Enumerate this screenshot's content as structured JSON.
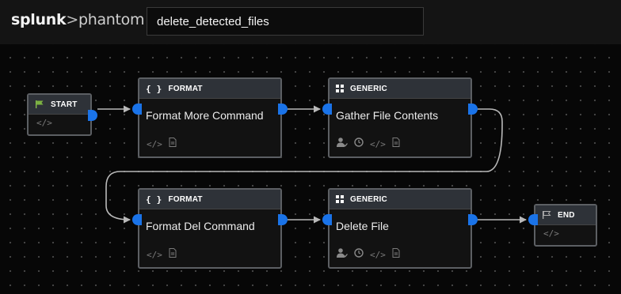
{
  "header": {
    "logo_brand": "splunk",
    "logo_sep": ">",
    "logo_product": "phantom",
    "playbook_name": "delete_detected_files"
  },
  "nodes": {
    "start": {
      "label": "START",
      "code_icon": "</>"
    },
    "end": {
      "label": "END",
      "code_icon": "</>"
    },
    "format_more": {
      "type": "FORMAT",
      "title": "Format More Command",
      "code_icon": "</>"
    },
    "gather": {
      "type": "GENERIC",
      "title": "Gather File Contents",
      "code_icon": "</>"
    },
    "format_del": {
      "type": "FORMAT",
      "title": "Format Del Command",
      "code_icon": "</>"
    },
    "delete": {
      "type": "GENERIC",
      "title": "Delete File",
      "code_icon": "</>"
    }
  },
  "colors": {
    "port": "#1a73e8",
    "link": "#b9b9b9",
    "start_flag": "#7cb342",
    "end_flag": "#b0b0b0"
  },
  "icons": {
    "format": "curly-braces-icon",
    "generic": "grid-icon",
    "user": "user-check-icon",
    "clock": "clock-icon",
    "code": "code-icon",
    "doc": "document-icon",
    "flag": "flag-icon"
  }
}
